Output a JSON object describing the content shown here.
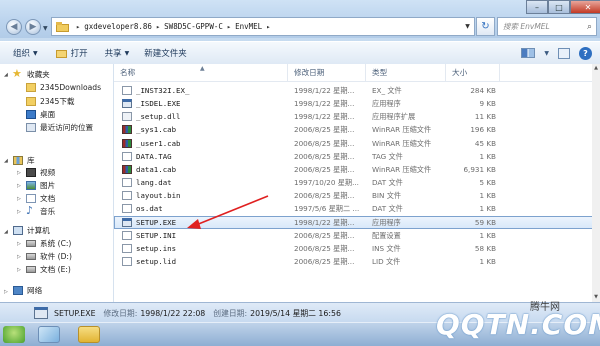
{
  "address": {
    "crumbs": [
      "gxdeveloper8.86",
      "SW8D5C-GPPW-C",
      "EnvMEL"
    ],
    "search_placeholder": "搜索 EnvMEL"
  },
  "toolbar": {
    "organize": "组织",
    "open": "打开",
    "share": "共享",
    "new_folder": "新建文件夹"
  },
  "nav": {
    "favorites": "收藏夹",
    "fav_items": [
      "2345Downloads",
      "2345下载",
      "桌面",
      "最近访问的位置"
    ],
    "libraries": "库",
    "lib_items": [
      "视频",
      "图片",
      "文档",
      "音乐"
    ],
    "computer": "计算机",
    "drives": [
      "系统 (C:)",
      "软件 (D:)",
      "文档 (E:)"
    ],
    "network": "网络"
  },
  "columns": {
    "name": "名称",
    "date": "修改日期",
    "type": "类型",
    "size": "大小"
  },
  "files": [
    {
      "name": "_INST32I.EX_",
      "date": "1998/1/22 星期...",
      "type": "EX_ 文件",
      "size": "284 KB",
      "icon": "file-icon"
    },
    {
      "name": "_ISDEL.EXE",
      "date": "1998/1/22 星期...",
      "type": "应用程序",
      "size": "9 KB",
      "icon": "exe-icon"
    },
    {
      "name": "_setup.dll",
      "date": "1998/1/22 星期...",
      "type": "应用程序扩展",
      "size": "11 KB",
      "icon": "dll-icon"
    },
    {
      "name": "_sys1.cab",
      "date": "2006/8/25 星期...",
      "type": "WinRAR 压缩文件",
      "size": "196 KB",
      "icon": "cab-icon"
    },
    {
      "name": "_user1.cab",
      "date": "2006/8/25 星期...",
      "type": "WinRAR 压缩文件",
      "size": "45 KB",
      "icon": "cab-icon"
    },
    {
      "name": "DATA.TAG",
      "date": "2006/8/25 星期...",
      "type": "TAG 文件",
      "size": "1 KB",
      "icon": "file-icon"
    },
    {
      "name": "data1.cab",
      "date": "2006/8/25 星期...",
      "type": "WinRAR 压缩文件",
      "size": "6,931 KB",
      "icon": "cab-icon"
    },
    {
      "name": "lang.dat",
      "date": "1997/10/20 星期...",
      "type": "DAT 文件",
      "size": "5 KB",
      "icon": "file-icon"
    },
    {
      "name": "layout.bin",
      "date": "2006/8/25 星期...",
      "type": "BIN 文件",
      "size": "1 KB",
      "icon": "file-icon"
    },
    {
      "name": "os.dat",
      "date": "1997/5/6 星期二 ...",
      "type": "DAT 文件",
      "size": "1 KB",
      "icon": "file-icon"
    },
    {
      "name": "SETUP.EXE",
      "date": "1998/1/22 星期...",
      "type": "应用程序",
      "size": "59 KB",
      "icon": "exe-icon",
      "selected": true
    },
    {
      "name": "SETUP.INI",
      "date": "2006/8/25 星期...",
      "type": "配置设置",
      "size": "1 KB",
      "icon": "ini-icon"
    },
    {
      "name": "setup.ins",
      "date": "2006/8/25 星期...",
      "type": "INS 文件",
      "size": "58 KB",
      "icon": "file-icon"
    },
    {
      "name": "setup.lid",
      "date": "2006/8/25 星期...",
      "type": "LID 文件",
      "size": "1 KB",
      "icon": "file-icon"
    }
  ],
  "details": {
    "name": "SETUP.EXE",
    "modified_label": "修改日期:",
    "modified_value": "1998/1/22 22:08",
    "created_label": "创建日期:",
    "created_value": "2019/5/14 星期二 16:56"
  },
  "watermark": {
    "logo": "QQTN.COM",
    "brand": "腾牛网"
  },
  "colors": {
    "annotation_arrow": "#e02020",
    "selection": "#d7e7f9"
  }
}
